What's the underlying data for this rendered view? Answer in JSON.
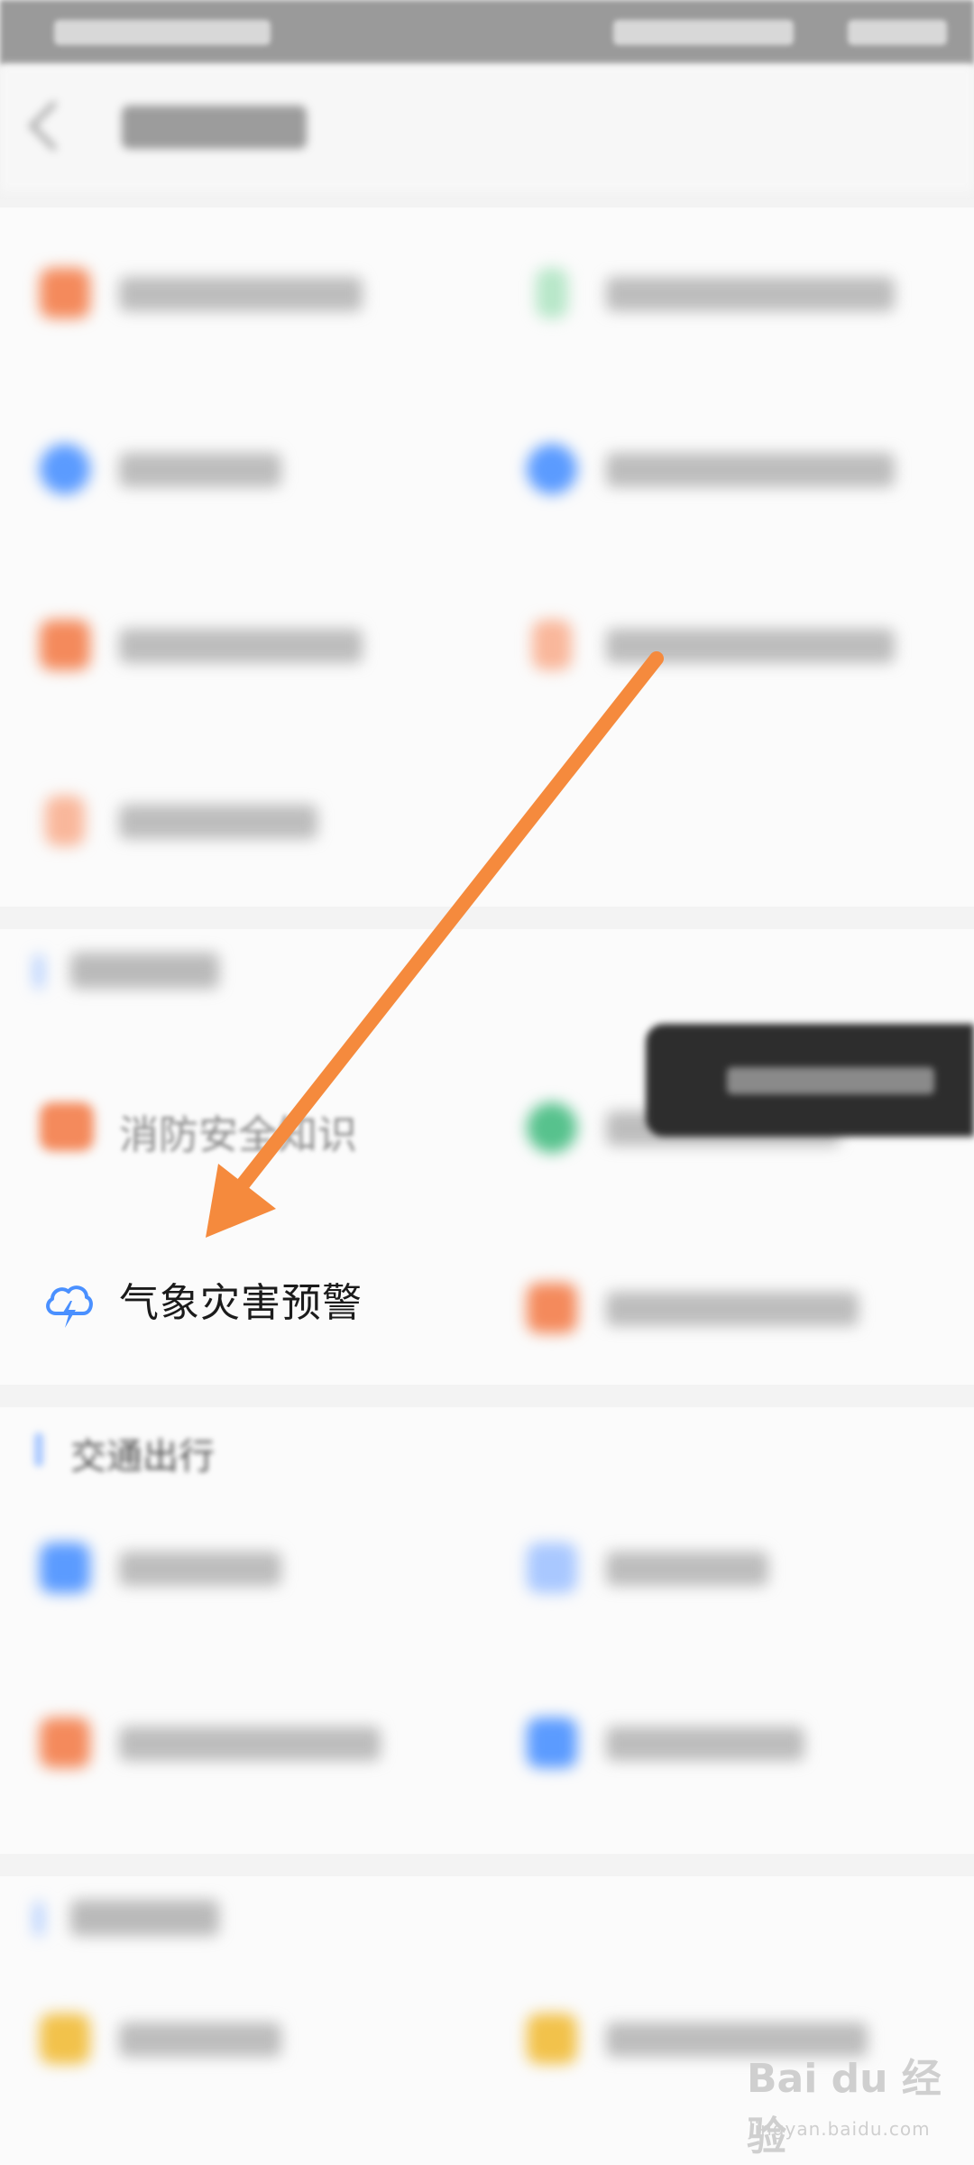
{
  "current_item": {
    "label": "气象灾害预警",
    "icon": "cloud-lightning-icon",
    "icon_color": "#4a90ff"
  },
  "partial_item": {
    "label": "消防安全知识"
  },
  "section_transport": {
    "title": "交通出行"
  },
  "colors": {
    "arrow": "#f58a3d",
    "orange_icon": "#f48a5c",
    "blue_icon": "#5b9bff",
    "green_icon": "#57c28d",
    "yellow_icon": "#f2c24b"
  },
  "watermark": {
    "brand": "Bai du 经验",
    "sub": "jingyan.baidu.com"
  }
}
